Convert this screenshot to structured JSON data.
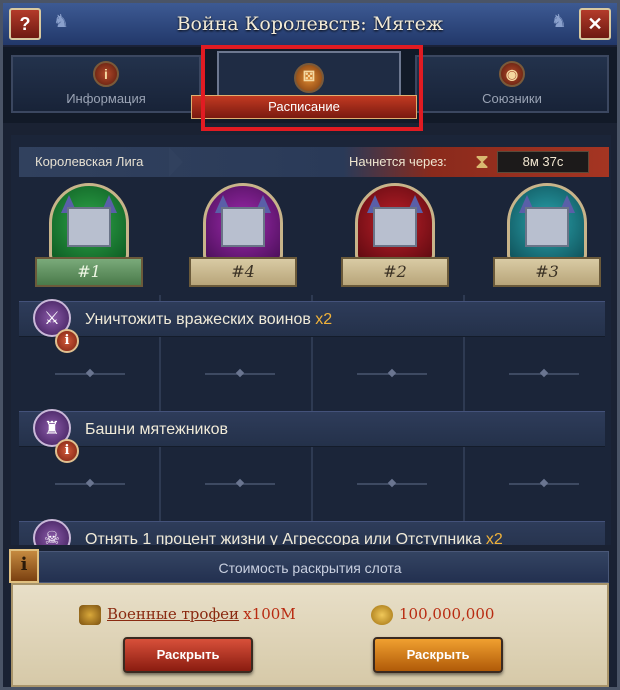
{
  "window": {
    "title": "Война Королевств: Мятеж",
    "help_label": "?",
    "close_label": "✕"
  },
  "tabs": [
    {
      "label": "Информация",
      "icon": "info-icon",
      "icon_glyph": "i"
    },
    {
      "label": "Расписание",
      "icon": "schedule-icon",
      "icon_glyph": "⚄",
      "active": true
    },
    {
      "label": "Союзники",
      "icon": "allies-icon",
      "icon_glyph": "◉"
    }
  ],
  "league": {
    "name": "Королевская Лига",
    "starts_label": "Начнется через:",
    "timer": "8м 37с"
  },
  "castles": [
    {
      "rank": "#1",
      "crest_color": "#2fa84a"
    },
    {
      "rank": "#4",
      "crest_color": "#a02ab0"
    },
    {
      "rank": "#2",
      "crest_color": "#c0202a"
    },
    {
      "rank": "#3",
      "crest_color": "#2aa6b0"
    }
  ],
  "tasks": [
    {
      "label": "Уничтожить вражеских воинов",
      "mult": "x2",
      "icon": "sword-icon",
      "info_glyph": "i"
    },
    {
      "label": "Башни мятежников",
      "mult": "",
      "icon": "tower-icon",
      "info_glyph": "i"
    },
    {
      "label": "Отнять 1 процент жизни у Агрессора или Отступника",
      "mult": "x2",
      "icon": "skull-icon",
      "info_glyph": ""
    }
  ],
  "slot": {
    "info_glyph": "i",
    "label": "Стоимость раскрытия слота",
    "cost1": {
      "name": "Военные трофеи",
      "qty": "x100M"
    },
    "cost2": {
      "amount": "100,000,000"
    },
    "reveal1": "Раскрыть",
    "reveal2": "Раскрыть"
  },
  "colors": {
    "accent_red": "#c23a22",
    "highlight": "#e11b22",
    "mult": "#f0b23a"
  }
}
